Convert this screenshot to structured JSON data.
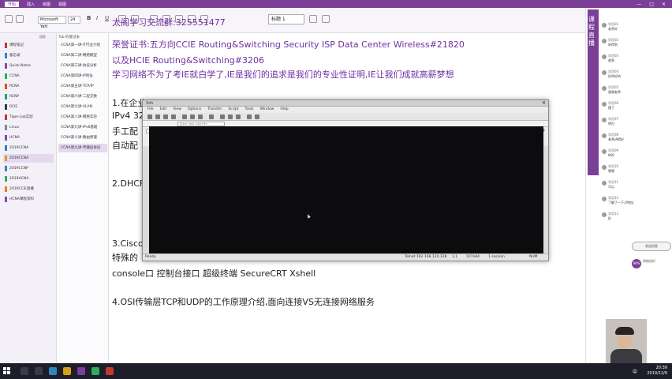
{
  "onenote": {
    "tabs": [
      "开始",
      "插入",
      "绘图",
      "视图"
    ],
    "font_name": "Microsoft YaH",
    "font_size": "24",
    "format_buttons": [
      "B",
      "I",
      "U"
    ],
    "style_heading": "标题 1",
    "accent": "#7b3f98"
  },
  "notebooks": {
    "search": "搜索",
    "items": [
      {
        "label": "课程笔记",
        "color": "#c0392b"
      },
      {
        "label": "备忘录",
        "color": "#2e86c1"
      },
      {
        "label": "Quick Notes",
        "color": "#8e44ad"
      },
      {
        "label": "CCNA",
        "color": "#27ae60"
      },
      {
        "label": "RCNA",
        "color": "#d35400"
      },
      {
        "label": "RCNP",
        "color": "#16a085"
      },
      {
        "label": "RCIE",
        "color": "#2c3e50"
      },
      {
        "label": "Tiger-Lab实验",
        "color": "#c0392b"
      },
      {
        "label": "Linux",
        "color": "#7f8c8d"
      },
      {
        "label": "HCNA",
        "color": "#8e44ad"
      },
      {
        "label": "2019CCNA",
        "color": "#2980b9"
      },
      {
        "label": "2019CCNA",
        "color": "#d4a017"
      },
      {
        "label": "2019CCNP",
        "color": "#2e86c1"
      },
      {
        "label": "2019HCNA",
        "color": "#27ae60"
      },
      {
        "label": "2019CCIE直播",
        "color": "#e67e22"
      },
      {
        "label": "HCNA课程资料",
        "color": "#8e44ad"
      }
    ],
    "selected_index": 11
  },
  "pages": {
    "header": "Tab 的键记本",
    "items": [
      "CCNA第一讲-IT行业介绍",
      "CCNA第二讲-网络模型",
      "CCNA第三讲-协议分析",
      "CCNA第四讲-IP地址",
      "CCNA第五讲-TCP/IP",
      "CCNA第六讲-二层交换",
      "CCNA第七讲-VLAN",
      "CCNA第八讲-网络实验",
      "CCNA第九讲-IPv6基础",
      "CCNA第十讲-路由原理",
      "CCNA第九讲-传输层协议"
    ],
    "selected_index": 10
  },
  "note": {
    "line_group": "太阁学习交流群:325551477",
    "line_cert": "荣誉证书:五方向CCIE Routing&Switching Security ISP Data Center Wireless#21820",
    "line_hcie": "以及HCIE Routing&Switching#3206",
    "line_motto": "学习网络不为了考IE就白学了,IE是我们的追求是我们的专业性证明,IE让我们成就高薪梦想",
    "item1": "1.在企业",
    "item1_a": "IPv4 32",
    "item1_b": "手工配",
    "item1_c": "自动配",
    "item2": "2.DHCF",
    "item3": "3.Cisco",
    "item3_a": "特殊的",
    "item3_b": "console口  控制台接口  超级终端   SecureCRT   Xshell",
    "item4": "4.OSI传输层TCP和UDP的工作原理介绍,面向连接VS无连接网络服务"
  },
  "xshell": {
    "title": "Xsh",
    "menu": [
      "File",
      "Edit",
      "View",
      "Options",
      "Transfer",
      "Script",
      "Tools",
      "Window",
      "Help"
    ],
    "address_placeholder": "Enter host <Alt+R>",
    "tab_label": "R1",
    "status_left": "Ready",
    "status_conn": "Telnet 192.168.124.128",
    "status_size": "107x84",
    "status_pos": "1,1",
    "status_sessions": "1 session",
    "status_caps": "NUM"
  },
  "chat": {
    "banner_text": "课程直播",
    "messages": [
      {
        "name": "学员01",
        "text": "老师好"
      },
      {
        "name": "学员02",
        "text": "听得到"
      },
      {
        "name": "学员03",
        "text": "收到"
      },
      {
        "name": "学员04",
        "text": "好的好的"
      },
      {
        "name": "学员05",
        "text": "谢谢老师"
      },
      {
        "name": "学员06",
        "text": "懂了"
      },
      {
        "name": "学员07",
        "text": "明白"
      },
      {
        "name": "学员08",
        "text": "老师讲得好"
      },
      {
        "name": "学员09",
        "text": "666"
      },
      {
        "name": "学员10",
        "text": "嗯嗯"
      },
      {
        "name": "学员11",
        "text": "可以"
      },
      {
        "name": "学员12",
        "text": "了解了一下,IP地址"
      },
      {
        "name": "学员13",
        "text": "好"
      }
    ],
    "tip": "发送消息",
    "percent": "98%",
    "percent_text": "网络良好"
  },
  "taskbar": {
    "clock_time": "20:39",
    "clock_date": "2019/12/9",
    "tray": "中"
  }
}
